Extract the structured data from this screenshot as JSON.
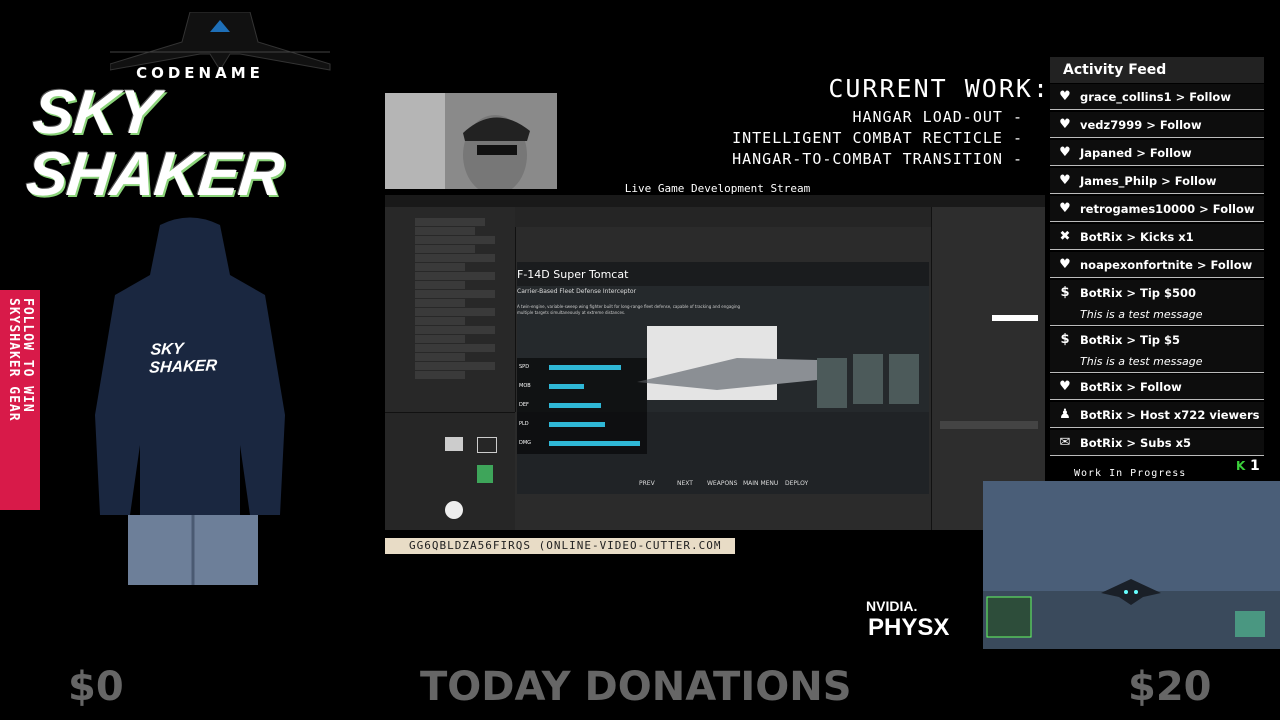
{
  "logo": {
    "codename": "CODENAME",
    "title": "SKY SHAKER"
  },
  "banner": {
    "line1": "FOLLOW TO WIN",
    "line2": "SKYSHAKER GEAR"
  },
  "hoodie_text": "SKY SHAKER",
  "current_work": {
    "title": "CURRENT WORK:",
    "items": [
      "HANGAR LOAD-OUT -",
      "INTELLIGENT COMBAT RECTICLE -",
      "HANGAR-TO-COMBAT TRANSITION -"
    ]
  },
  "stream_title": "Live Game Development Stream",
  "game_view": {
    "title": "F-14D Super Tomcat",
    "subtitle": "Carrier-Based Fleet Defense Interceptor",
    "description": "A twin-engine, variable-sweep wing fighter built for long-range fleet defense, capable of tracking and engaging multiple targets simultaneously at extreme distances.",
    "stats": [
      {
        "label": "SPD",
        "value": 0.55
      },
      {
        "label": "MOB",
        "value": 0.27
      },
      {
        "label": "DEF",
        "value": 0.4
      },
      {
        "label": "PLD",
        "value": 0.43
      },
      {
        "label": "DMG",
        "value": 0.7
      }
    ],
    "buttons": [
      "PREV",
      "NEXT",
      "WEAPONS",
      "MAIN MENU",
      "DEPLOY"
    ]
  },
  "ticker": "GG6QBLDZA56FIRQS (ONLINE-VIDEO-CUTTER.COM",
  "activity_feed": {
    "title": "Activity Feed",
    "items": [
      {
        "icon": "heart-icon",
        "text": "grace_collins1 > Follow",
        "message": ""
      },
      {
        "icon": "heart-icon",
        "text": "vedz7999 > Follow",
        "message": ""
      },
      {
        "icon": "heart-icon",
        "text": "Japaned > Follow",
        "message": ""
      },
      {
        "icon": "heart-icon",
        "text": "James_Philp > Follow",
        "message": ""
      },
      {
        "icon": "heart-icon",
        "text": "retrogames10000 > Follow",
        "message": ""
      },
      {
        "icon": "kick-icon",
        "text": "BotRix > Kicks x1",
        "message": ""
      },
      {
        "icon": "heart-icon",
        "text": "noapexonfortnite > Follow",
        "message": ""
      },
      {
        "icon": "money-icon",
        "text": "BotRix > Tip $500",
        "message": "This is a test message"
      },
      {
        "icon": "money-icon",
        "text": "BotRix > Tip $5",
        "message": "This is a test message"
      },
      {
        "icon": "heart-icon",
        "text": "BotRix > Follow",
        "message": ""
      },
      {
        "icon": "people-icon",
        "text": "BotRix > Host x722 viewers",
        "message": ""
      },
      {
        "icon": "gift-icon",
        "text": "BotRix > Subs x5",
        "message": ""
      }
    ]
  },
  "wip": {
    "label": "Work In Progress",
    "count": "1"
  },
  "physx": {
    "brand": "NVIDIA.",
    "product": "PHYSX"
  },
  "donations": {
    "left": "$0",
    "label": "TODAY DONATIONS",
    "right": "$20"
  },
  "colors": {
    "banner": "#d81a49",
    "bar": "#2fb7d6",
    "accent_green": "#3bd13b"
  }
}
